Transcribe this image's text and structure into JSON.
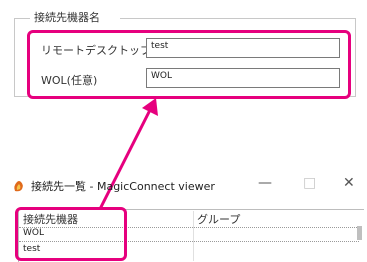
{
  "settings_dialog": {
    "group_title": "接続先機器名",
    "remote_desktop_label": "リモートデスクトップ",
    "remote_desktop_value": "test",
    "wol_label": "WOL(任意)",
    "wol_value": "WOL"
  },
  "viewer_window": {
    "title": "接続先一覧 - MagicConnect viewer",
    "minimize": "—",
    "maximize": "□",
    "close": "✕",
    "columns": [
      "接続先機器",
      "グループ"
    ],
    "rows": [
      "WOL",
      "test"
    ]
  },
  "annotation": {
    "highlight_color": "#e6007e"
  }
}
